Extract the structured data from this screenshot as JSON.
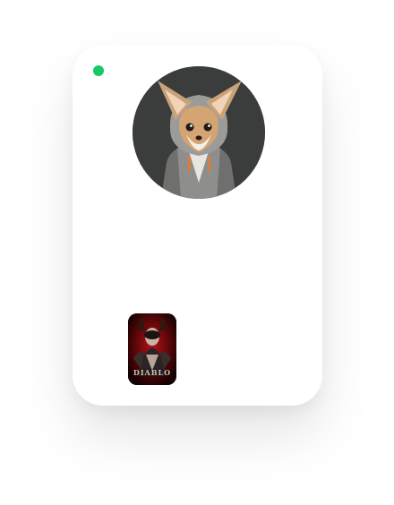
{
  "profile": {
    "status": "online",
    "status_color": "#17c964",
    "avatar_icon": "fox-character-avatar"
  },
  "game": {
    "title": "DIABLO",
    "cover_icon": "diablo-game-cover"
  }
}
